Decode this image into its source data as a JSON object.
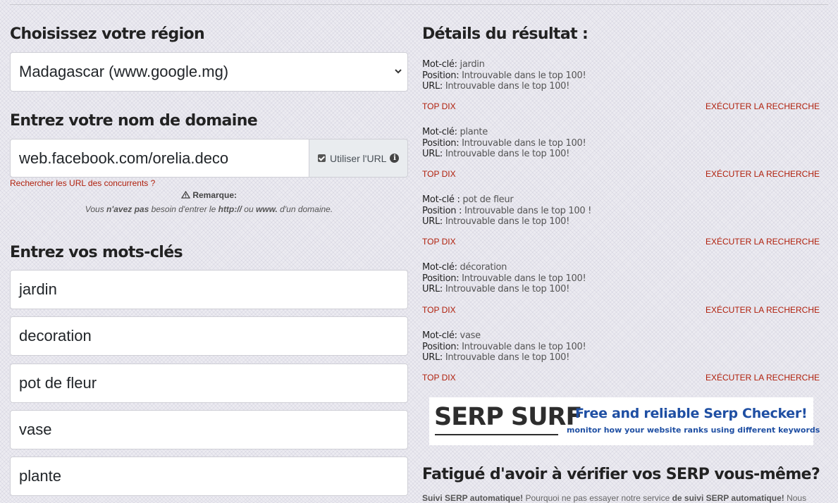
{
  "region": {
    "heading": "Choisissez votre région",
    "selected": "Madagascar (www.google.mg)"
  },
  "domain": {
    "heading": "Entrez votre nom de domaine",
    "value": "web.facebook.com/orelia.deco",
    "use_url_label": "Utiliser l'URL",
    "competitor_link": "Rechercher les URL des concurrents ?",
    "remark_title": "Remarque:",
    "remark_parts": [
      "Vous ",
      "n'avez pas",
      " besoin d'entrer le ",
      "http://",
      " ou ",
      "www.",
      " d'un domaine."
    ]
  },
  "keywords": {
    "heading": "Entrez vos mots-clés",
    "values": [
      "jardin",
      "decoration",
      "pot de fleur",
      "vase",
      "plante"
    ]
  },
  "results": {
    "heading": "Détails du résultat :",
    "top_ten_label": "TOP DIX",
    "run_search_label": "EXÉCUTER LA RECHERCHE",
    "items": [
      {
        "kw_label": "Mot-clé:",
        "kw": "jardin",
        "pos_label": "Position:",
        "pos": "Introuvable dans le top 100!",
        "url_label": "URL:",
        "url": "Introuvable dans le top 100!"
      },
      {
        "kw_label": "Mot-clé:",
        "kw": "plante",
        "pos_label": "Position:",
        "pos": "Introuvable dans le top 100!",
        "url_label": "URL:",
        "url": "Introuvable dans le top 100!"
      },
      {
        "kw_label": "Mot-clé :",
        "kw": "pot de fleur",
        "pos_label": "Position :",
        "pos": "Introuvable dans le top 100 !",
        "url_label": "URL:",
        "url": "Introuvable dans le top 100!"
      },
      {
        "kw_label": "Mot-clé:",
        "kw": "décoration",
        "pos_label": "Position:",
        "pos": "Introuvable dans le top 100!",
        "url_label": "URL:",
        "url": "Introuvable dans le top 100!"
      },
      {
        "kw_label": "Mot-clé:",
        "kw": "vase",
        "pos_label": "Position:",
        "pos": "Introuvable dans le top 100!",
        "url_label": "URL:",
        "url": "Introuvable dans le top 100!"
      }
    ]
  },
  "banner": {
    "logo": "SERP SURF",
    "tagline": "Free and reliable Serp Checker!",
    "subline": "monitor how your website ranks using different keywords"
  },
  "promo": {
    "heading": "Fatigué d'avoir à vérifier vos SERP vous-même?",
    "text_bold1": "Suivi SERP automatique!",
    "text_mid": " Pourquoi ne pas essayer notre service ",
    "text_bold2": "de suivi SERP automatique!",
    "text_end": " Nous"
  },
  "colors": {
    "link": "#b0200c",
    "banner_blue": "#1f4fa3"
  }
}
